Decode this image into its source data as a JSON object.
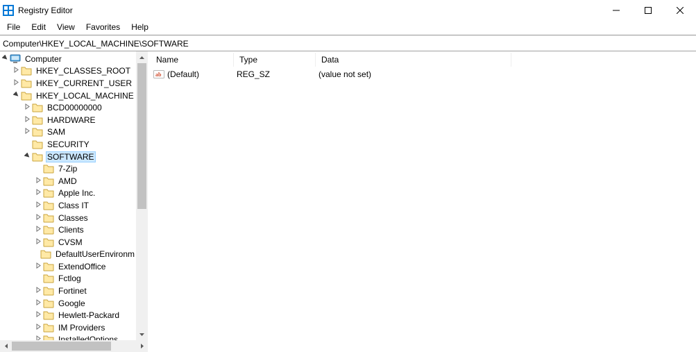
{
  "window": {
    "title": "Registry Editor"
  },
  "menu": [
    "File",
    "Edit",
    "View",
    "Favorites",
    "Help"
  ],
  "address": "Computer\\HKEY_LOCAL_MACHINE\\SOFTWARE",
  "listColumns": {
    "name": "Name",
    "type": "Type",
    "data": "Data"
  },
  "listRows": [
    {
      "name": "(Default)",
      "type": "REG_SZ",
      "data": "(value not set)"
    }
  ],
  "tree": {
    "root": "Computer",
    "hives": [
      {
        "label": "HKEY_CLASSES_ROOT",
        "exp": "closed"
      },
      {
        "label": "HKEY_CURRENT_USER",
        "exp": "closed"
      },
      {
        "label": "HKEY_LOCAL_MACHINE",
        "exp": "open",
        "children": [
          {
            "label": "BCD00000000",
            "exp": "closed"
          },
          {
            "label": "HARDWARE",
            "exp": "closed"
          },
          {
            "label": "SAM",
            "exp": "closed"
          },
          {
            "label": "SECURITY",
            "exp": "none"
          },
          {
            "label": "SOFTWARE",
            "exp": "open",
            "selected": true,
            "children": [
              {
                "label": "7-Zip",
                "exp": "none"
              },
              {
                "label": "AMD",
                "exp": "closed"
              },
              {
                "label": "Apple Inc.",
                "exp": "closed"
              },
              {
                "label": "Class IT",
                "exp": "closed"
              },
              {
                "label": "Classes",
                "exp": "closed"
              },
              {
                "label": "Clients",
                "exp": "closed"
              },
              {
                "label": "CVSM",
                "exp": "closed"
              },
              {
                "label": "DefaultUserEnvironm",
                "exp": "none"
              },
              {
                "label": "ExtendOffice",
                "exp": "closed"
              },
              {
                "label": "Fctlog",
                "exp": "none"
              },
              {
                "label": "Fortinet",
                "exp": "closed"
              },
              {
                "label": "Google",
                "exp": "closed"
              },
              {
                "label": "Hewlett-Packard",
                "exp": "closed"
              },
              {
                "label": "IM Providers",
                "exp": "closed"
              },
              {
                "label": "InstalledOptions",
                "exp": "closed"
              }
            ]
          }
        ]
      }
    ]
  }
}
